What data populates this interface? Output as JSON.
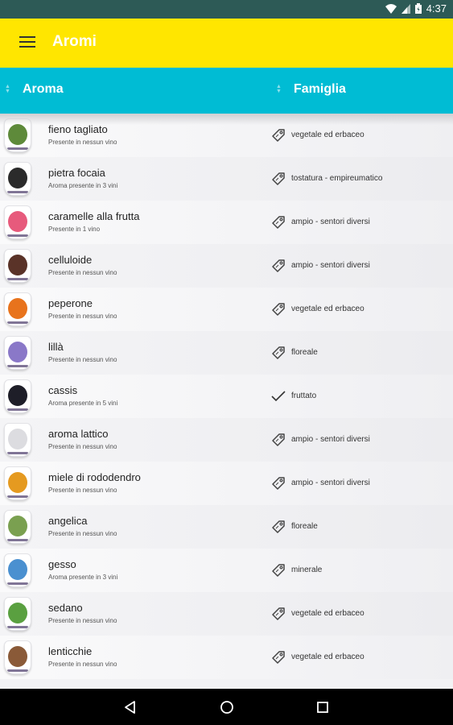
{
  "status": {
    "time": "4:37"
  },
  "toolbar": {
    "title": "Aromi",
    "menu_icon": "hamburger-menu-icon"
  },
  "header": {
    "col_aroma": "Aroma",
    "col_famiglia": "Famiglia"
  },
  "colors": {
    "toolbar": "#ffe600",
    "header": "#00bcd4"
  },
  "rows": [
    {
      "name": "fieno tagliato",
      "sub": "Presente in nessun vino",
      "family": "vegetale ed erbaceo",
      "icon": "tag-icon",
      "color": "#5e8a3a"
    },
    {
      "name": "pietra focaia",
      "sub": "Aroma presente in 3 vini",
      "family": "tostatura - empireumatico",
      "icon": "tag-icon",
      "color": "#2b2b2b"
    },
    {
      "name": "caramelle alla frutta",
      "sub": "Presente in 1 vino",
      "family": "ampio - sentori diversi",
      "icon": "tag-icon",
      "color": "#e75a7c"
    },
    {
      "name": "celluloide",
      "sub": "Presente in nessun vino",
      "family": "ampio - sentori diversi",
      "icon": "tag-icon",
      "color": "#5a3328"
    },
    {
      "name": "peperone",
      "sub": "Presente in nessun vino",
      "family": "vegetale ed erbaceo",
      "icon": "tag-icon",
      "color": "#e8731c"
    },
    {
      "name": "lillà",
      "sub": "Presente in nessun vino",
      "family": "floreale",
      "icon": "tag-icon",
      "color": "#8a78c8"
    },
    {
      "name": "cassis",
      "sub": "Aroma presente in 5 vini",
      "family": "fruttato",
      "icon": "check-icon",
      "color": "#1e1e28"
    },
    {
      "name": "aroma lattico",
      "sub": "Presente in nessun vino",
      "family": "ampio - sentori diversi",
      "icon": "tag-icon",
      "color": "#dcdce0"
    },
    {
      "name": "miele di rododendro",
      "sub": "Presente in nessun vino",
      "family": "ampio - sentori diversi",
      "icon": "tag-icon",
      "color": "#e59a20"
    },
    {
      "name": "angelica",
      "sub": "Presente in nessun vino",
      "family": "floreale",
      "icon": "tag-icon",
      "color": "#7aa050"
    },
    {
      "name": "gesso",
      "sub": "Aroma presente in 3 vini",
      "family": "minerale",
      "icon": "tag-icon",
      "color": "#4a90d0"
    },
    {
      "name": "sedano",
      "sub": "Presente in nessun vino",
      "family": "vegetale ed erbaceo",
      "icon": "tag-icon",
      "color": "#5aa040"
    },
    {
      "name": "lenticchie",
      "sub": "Presente in nessun vino",
      "family": "vegetale ed erbaceo",
      "icon": "tag-icon",
      "color": "#8a5a38"
    }
  ]
}
